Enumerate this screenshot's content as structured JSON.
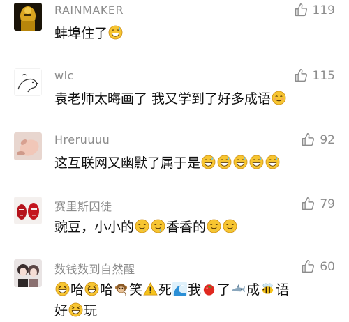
{
  "comments": [
    {
      "name": "RAINMAKER",
      "likes": "119",
      "segments": [
        "蚌埠住了"
      ],
      "avatar": "black-yellow-figure-avatar"
    },
    {
      "name": "wlc",
      "likes": "115",
      "segments": [
        "袁老师太晦画了 我又学到了好多成语"
      ],
      "avatar": "line-drawing-animal-avatar"
    },
    {
      "name": "Hreruuuu",
      "likes": "92",
      "segments": [
        "这互联网又幽默了属于是"
      ],
      "avatar": "pink-hand-avatar"
    },
    {
      "name": "赛里斯囚徒",
      "likes": "79",
      "segments": [
        "豌豆，小小的",
        "香香的"
      ],
      "avatar": "red-faces-avatar"
    },
    {
      "name": "数钱数到自然醒",
      "likes": "60",
      "segments": [
        "哈",
        "哈",
        "笑",
        "死",
        "我",
        "了",
        "成",
        "语",
        "好",
        "玩"
      ],
      "avatar": "anime-duo-avatar"
    }
  ],
  "colors": {
    "name": "#8c8c8c",
    "text": "#111111",
    "emoji_face": "#f7c531",
    "emoji_outline": "#c98b12"
  },
  "icons": {
    "like": "thumbs-up-outline-icon"
  }
}
